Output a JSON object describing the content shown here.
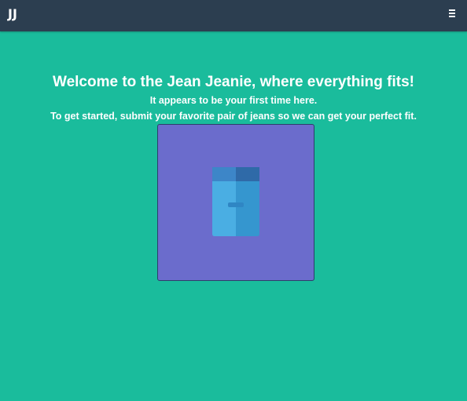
{
  "navbar": {
    "brand": "JJ",
    "menu_icon": "hamburger-menu-icon"
  },
  "intro": {
    "heading": "Welcome to the Jean Jeanie, where everything fits!",
    "line1": "It appears to be your first time here.",
    "line2": "To get started, submit your favorite pair of jeans so we can get your perfect fit."
  },
  "upload": {
    "icon": "jeans-icon"
  },
  "colors": {
    "background": "#1abc9c",
    "navbar": "#2c3e50",
    "upload_box": "#6b6ccc",
    "jeans_light": "#4aaee3",
    "jeans_dark": "#3596cf"
  }
}
